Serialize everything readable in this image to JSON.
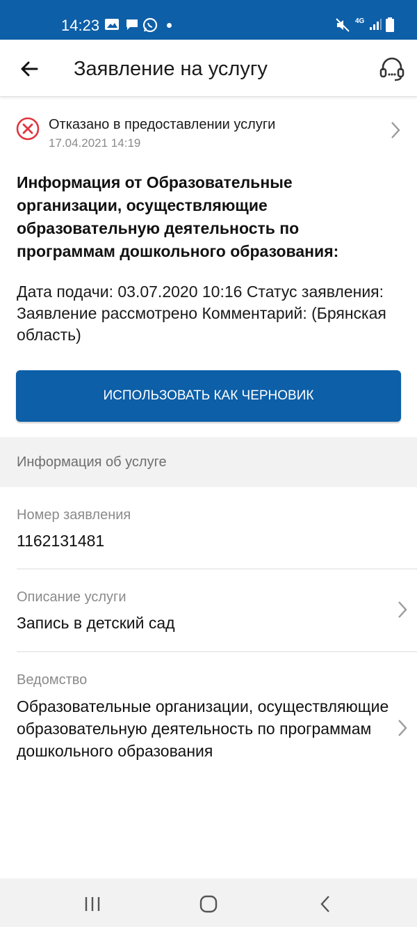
{
  "status_bar": {
    "time": "14:23",
    "network": "4G",
    "icons": [
      "gallery-icon",
      "message-icon",
      "whatsapp-icon",
      "notification-dot-icon",
      "mute-icon",
      "signal-icon",
      "battery-icon"
    ]
  },
  "app_bar": {
    "title": "Заявление на услугу",
    "back_icon": "arrow-left-icon",
    "support_icon": "headset-icon"
  },
  "status": {
    "text": "Отказано в предоставлении услуги",
    "date": "17.04.2021 14:19",
    "icon": "error-circle-icon",
    "color": "#e0353f"
  },
  "info": {
    "heading": "Информация от Образовательные организации, осуществляющие образовательную деятельность по программам дошкольного образования:",
    "text": "Дата подачи: 03.07.2020 10:16 Статус заявления: Заявление рассмотрено Комментарий: (Брянская область)"
  },
  "actions": {
    "draft_button_label": "ИСПОЛЬЗОВАТЬ КАК ЧЕРНОВИК"
  },
  "service_info": {
    "section_title": "Информация об услуге",
    "fields": [
      {
        "label": "Номер заявления",
        "value": "1162131481"
      },
      {
        "label": "Описание услуги",
        "value": "Запись в детский сад"
      },
      {
        "label": "Ведомство",
        "value": "Образовательные организации, осуществляющие образовательную деятельность по программам дошкольного образования"
      }
    ]
  },
  "colors": {
    "primary": "#0d5fa8",
    "error": "#e0353f",
    "section_bg": "#f2f2f2"
  }
}
